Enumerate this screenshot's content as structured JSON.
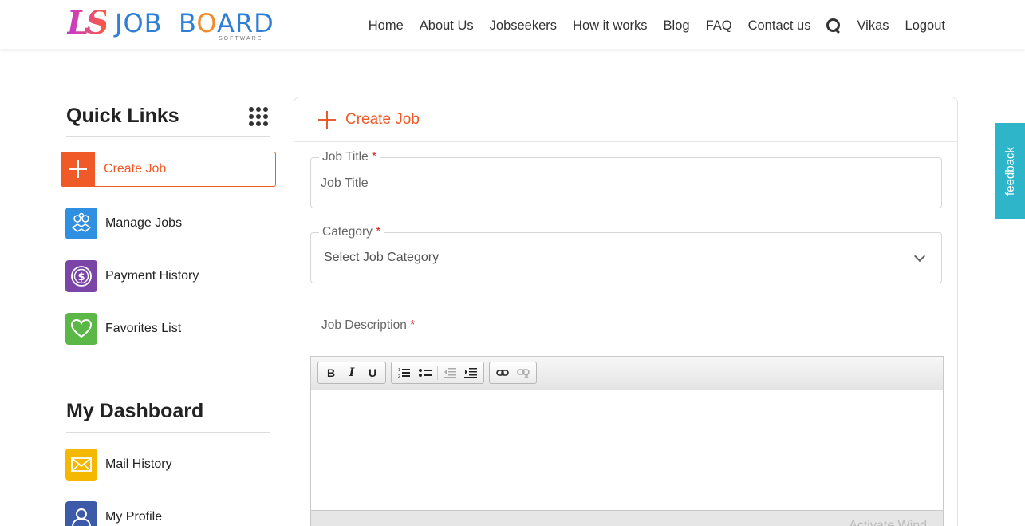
{
  "brand": {
    "logo_mark": "LS",
    "logo_word1": "JOB",
    "logo_word2_pre": "B",
    "logo_word2_accent": "O",
    "logo_word2_post": "ARD",
    "logo_sub": "SOFTWARE"
  },
  "nav": {
    "items": [
      "Home",
      "About Us",
      "Jobseekers",
      "How it works",
      "Blog",
      "FAQ",
      "Contact us"
    ],
    "search_icon": "search-icon",
    "user": "Vikas",
    "logout": "Logout"
  },
  "sidebar": {
    "quick_links_title": "Quick Links",
    "quick_links": [
      {
        "label": "Create Job",
        "icon": "plus-icon",
        "color": "#f05a28"
      },
      {
        "label": "Manage Jobs",
        "icon": "handshake-gears-icon",
        "color": "#2f8fe0"
      },
      {
        "label": "Payment History",
        "icon": "dollar-coin-icon",
        "color": "#7b45a8"
      },
      {
        "label": "Favorites List",
        "icon": "heart-icon",
        "color": "#5bb847"
      }
    ],
    "dashboard_title": "My Dashboard",
    "dashboard_links": [
      {
        "label": "Mail History",
        "icon": "envelope-icon",
        "color": "#f5b800"
      },
      {
        "label": "My Profile",
        "icon": "user-icon",
        "color": "#3c5aa8"
      }
    ]
  },
  "form": {
    "title": "Create Job",
    "job_title_label": "Job Title",
    "job_title_placeholder": "Job Title",
    "required_mark": "*",
    "category_label": "Category",
    "category_value": "Select Job Category",
    "description_label": "Job Description",
    "watermark": "Activate Wind"
  },
  "feedback": "feedback",
  "colors": {
    "accent": "#f05a28",
    "feedback_bg": "#2fb5c9"
  }
}
